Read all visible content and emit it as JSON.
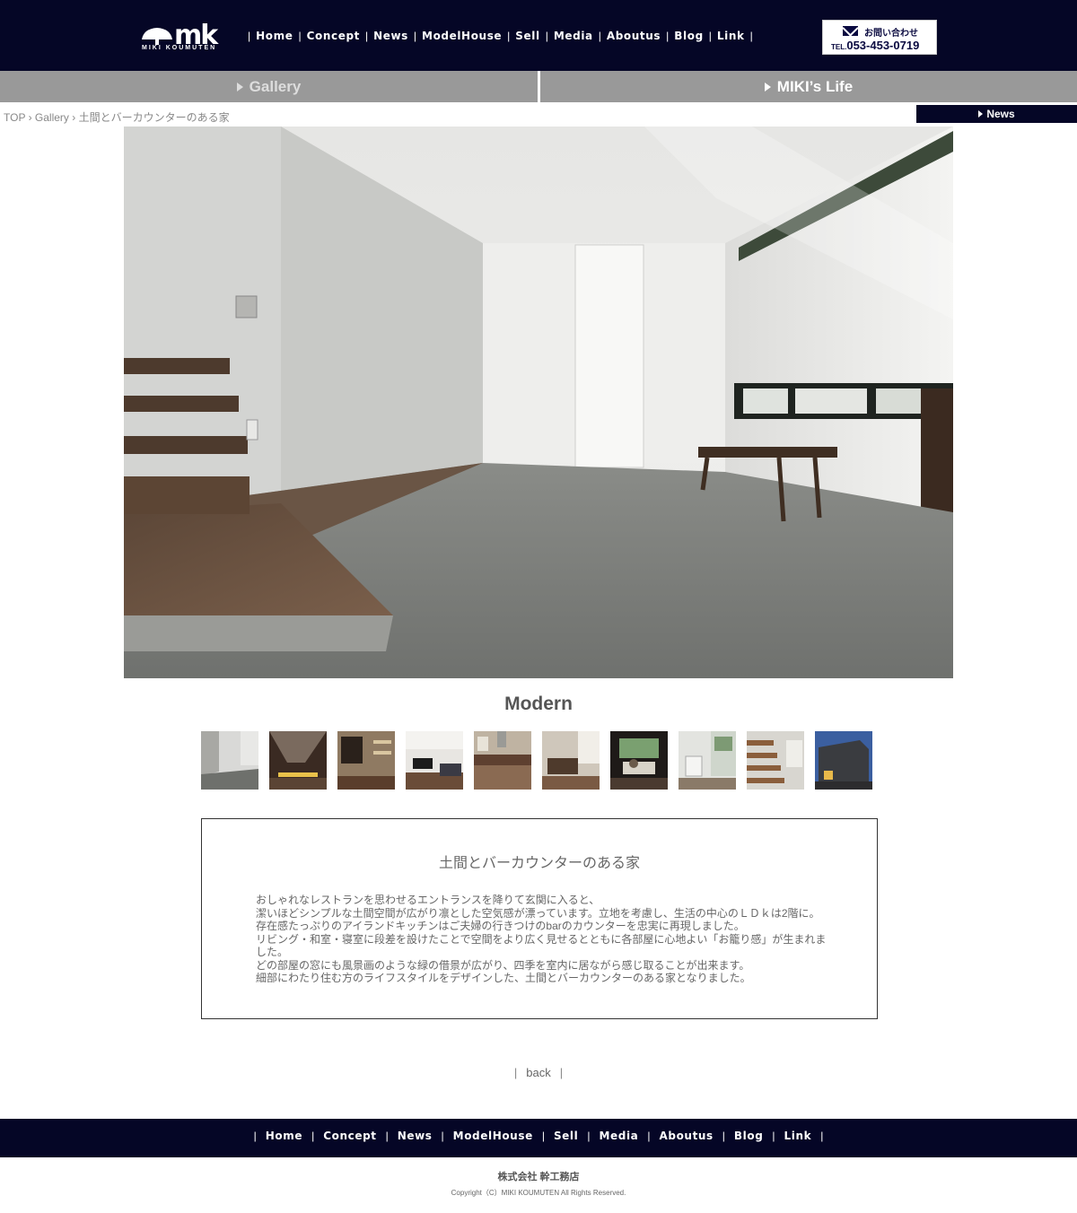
{
  "header": {
    "logo_mark": "mk",
    "logo_sub": "MIKI KOUMUTEN",
    "nav": [
      "Home",
      "Concept",
      "News",
      "ModelHouse",
      "Sell",
      "Media",
      "Aboutus",
      "Blog",
      "Link"
    ],
    "contact_label": "お問い合わせ",
    "contact_tel_prefix": "TEL.",
    "contact_tel": "053-453-0719"
  },
  "categories": {
    "gallery": "Gallery",
    "life": "MIKI’s Life"
  },
  "breadcrumb": "TOP › Gallery › 土間とバーカウンターのある家",
  "news_button": "News",
  "gallery": {
    "title": "Modern",
    "thumbnails": [
      "entrance",
      "hallway",
      "living",
      "living-tv",
      "kitchen",
      "dining",
      "window-seat",
      "bathroom",
      "stairs",
      "exterior"
    ]
  },
  "description": {
    "heading": "土間とバーカウンターのある家",
    "lines": [
      "おしゃれなレストランを思わせるエントランスを降りて玄関に入ると、",
      "潔いほどシンプルな土間空間が広がり凛とした空気感が漂っています。立地を考慮し、生活の中心のＬＤｋは2階に。",
      "存在感たっぷりのアイランドキッチンはご夫婦の行きつけのbarのカウンターを忠実に再現しました。",
      "リビング・和室・寝室に段差を設けたことで空間をより広く見せるとともに各部屋に心地よい「お籠り感」が生まれました。",
      "どの部屋の窓にも風景画のような緑の借景が広がり、四季を室内に居ながら感じ取ることが出来ます。",
      "細部にわたり住む方のライフスタイルをデザインした、土間とバーカウンターのある家となりました。"
    ]
  },
  "back_label": "back",
  "footer": {
    "nav": [
      "Home",
      "Concept",
      "News",
      "ModelHouse",
      "Sell",
      "Media",
      "Aboutus",
      "Blog",
      "Link"
    ],
    "company": "株式会社 幹工務店",
    "copyright": "Copyright（C）MIKI KOUMUTEN All Rights Reserved."
  },
  "colors": {
    "navy": "#050626",
    "category_gray": "#999999"
  }
}
